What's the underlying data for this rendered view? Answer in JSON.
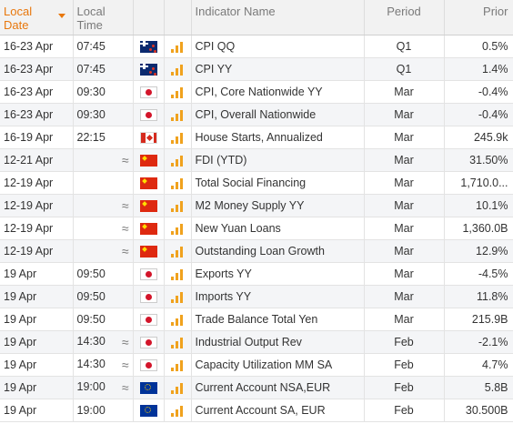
{
  "headers": {
    "local_date": "Local\nDate",
    "local_time": "Local\nTime",
    "indicator": "Indicator Name",
    "period": "Period",
    "prior": "Prior"
  },
  "colors": {
    "accent": "#e8770c",
    "impact_bar": "#f0a21e"
  },
  "rows": [
    {
      "date": "16-23 Apr",
      "time": "07:45",
      "approx": false,
      "flag": "new-zealand-flag-icon",
      "indicator": "CPI QQ",
      "period": "Q1",
      "prior": "0.5%"
    },
    {
      "date": "16-23 Apr",
      "time": "07:45",
      "approx": false,
      "flag": "new-zealand-flag-icon",
      "indicator": "CPI YY",
      "period": "Q1",
      "prior": "1.4%"
    },
    {
      "date": "16-23 Apr",
      "time": "09:30",
      "approx": false,
      "flag": "japan-flag-icon",
      "indicator": "CPI, Core Nationwide YY",
      "period": "Mar",
      "prior": "-0.4%"
    },
    {
      "date": "16-23 Apr",
      "time": "09:30",
      "approx": false,
      "flag": "japan-flag-icon",
      "indicator": "CPI, Overall Nationwide",
      "period": "Mar",
      "prior": "-0.4%"
    },
    {
      "date": "16-19 Apr",
      "time": "22:15",
      "approx": false,
      "flag": "canada-flag-icon",
      "indicator": "House Starts, Annualized",
      "period": "Mar",
      "prior": "245.9k"
    },
    {
      "date": "12-21 Apr",
      "time": "",
      "approx": true,
      "flag": "china-flag-icon",
      "indicator": "FDI (YTD)",
      "period": "Mar",
      "prior": "31.50%"
    },
    {
      "date": "12-19 Apr",
      "time": "",
      "approx": false,
      "flag": "china-flag-icon",
      "indicator": "Total Social Financing",
      "period": "Mar",
      "prior": "1,710.0..."
    },
    {
      "date": "12-19 Apr",
      "time": "",
      "approx": true,
      "flag": "china-flag-icon",
      "indicator": "M2 Money Supply YY",
      "period": "Mar",
      "prior": "10.1%"
    },
    {
      "date": "12-19 Apr",
      "time": "",
      "approx": true,
      "flag": "china-flag-icon",
      "indicator": "New Yuan Loans",
      "period": "Mar",
      "prior": "1,360.0B"
    },
    {
      "date": "12-19 Apr",
      "time": "",
      "approx": true,
      "flag": "china-flag-icon",
      "indicator": "Outstanding Loan Growth",
      "period": "Mar",
      "prior": "12.9%"
    },
    {
      "date": "19 Apr",
      "time": "09:50",
      "approx": false,
      "flag": "japan-flag-icon",
      "indicator": "Exports YY",
      "period": "Mar",
      "prior": "-4.5%"
    },
    {
      "date": "19 Apr",
      "time": "09:50",
      "approx": false,
      "flag": "japan-flag-icon",
      "indicator": "Imports YY",
      "period": "Mar",
      "prior": "11.8%"
    },
    {
      "date": "19 Apr",
      "time": "09:50",
      "approx": false,
      "flag": "japan-flag-icon",
      "indicator": "Trade Balance Total Yen",
      "period": "Mar",
      "prior": "215.9B"
    },
    {
      "date": "19 Apr",
      "time": "14:30",
      "approx": true,
      "flag": "japan-flag-icon",
      "indicator": "Industrial Output Rev",
      "period": "Feb",
      "prior": "-2.1%"
    },
    {
      "date": "19 Apr",
      "time": "14:30",
      "approx": true,
      "flag": "japan-flag-icon",
      "indicator": "Capacity Utilization MM SA",
      "period": "Feb",
      "prior": "4.7%"
    },
    {
      "date": "19 Apr",
      "time": "19:00",
      "approx": true,
      "flag": "eurozone-flag-icon",
      "indicator": "Current Account NSA,EUR",
      "period": "Feb",
      "prior": "5.8B"
    },
    {
      "date": "19 Apr",
      "time": "19:00",
      "approx": false,
      "flag": "eurozone-flag-icon",
      "indicator": "Current Account SA, EUR",
      "period": "Feb",
      "prior": "30.500B"
    }
  ]
}
